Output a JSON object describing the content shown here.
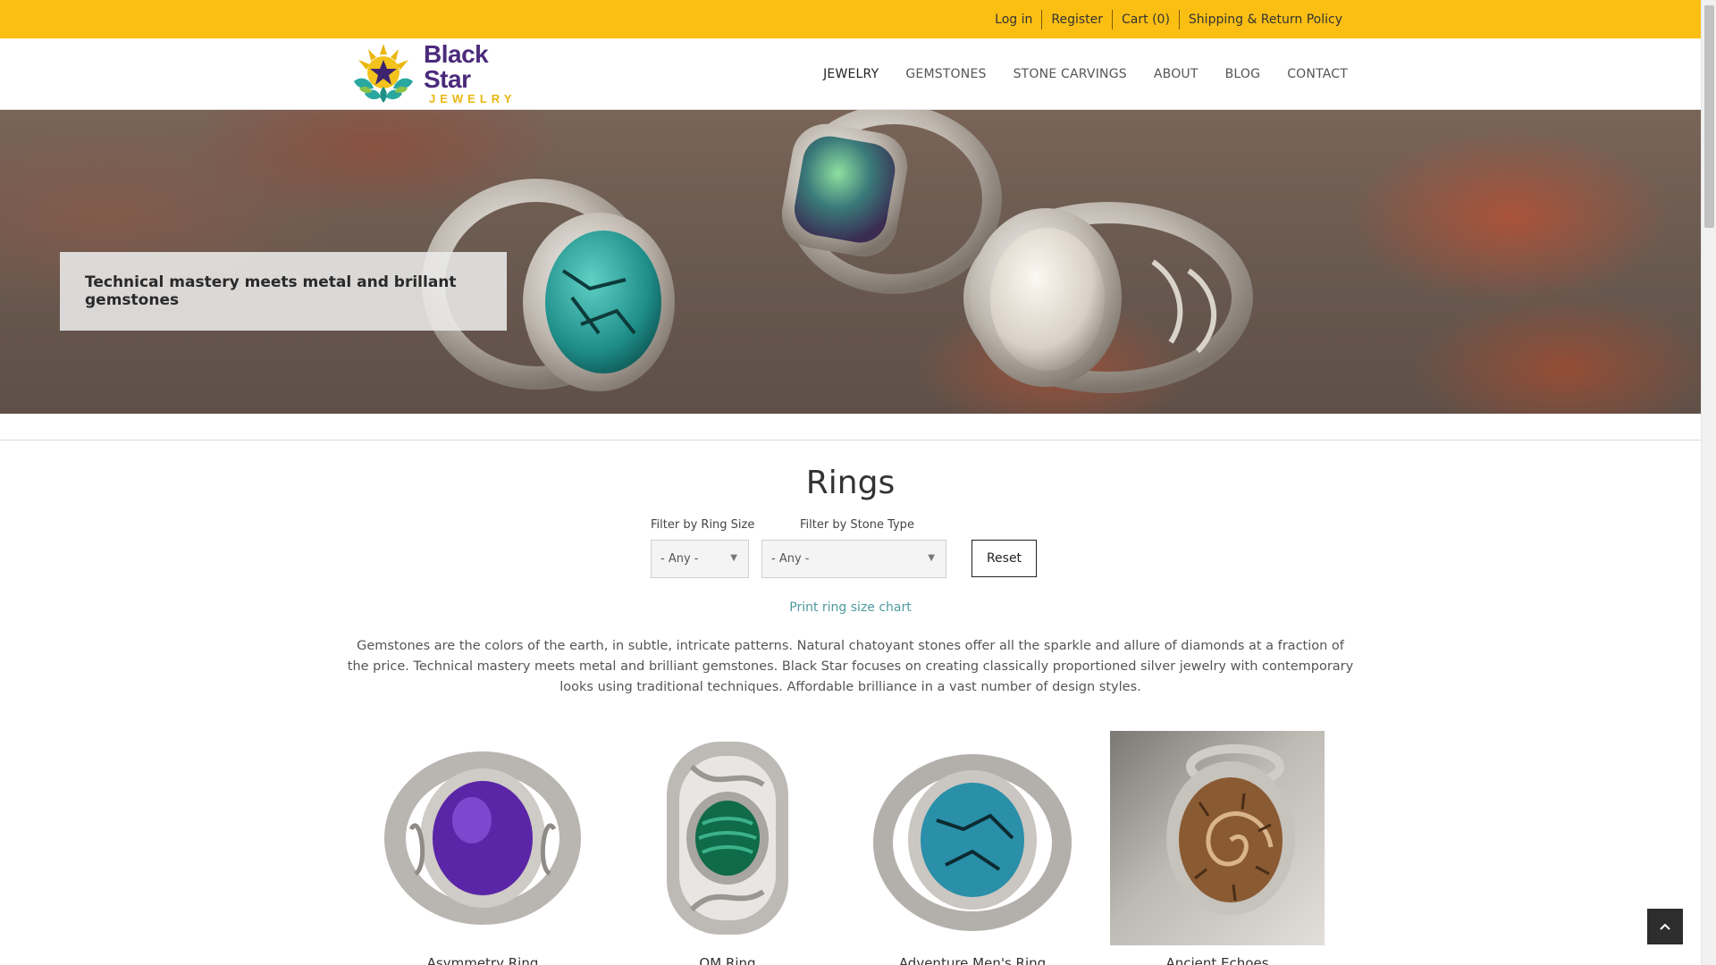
{
  "topbar": {
    "links": [
      "Log in",
      "Register",
      "Cart (0)",
      "Shipping & Return Policy"
    ]
  },
  "logo": {
    "line1": "Black Star",
    "line2": "JEWELRY",
    "colors": {
      "purple": "#4b2a7b",
      "gold": "#e9b70f",
      "teal": "#2aa8a0"
    }
  },
  "nav": {
    "items": [
      "JEWELRY",
      "GEMSTONES",
      "STONE CARVINGS",
      "ABOUT",
      "BLOG",
      "CONTACT"
    ],
    "active": "JEWELRY"
  },
  "hero": {
    "caption": "Technical mastery meets metal and brillant gemstones"
  },
  "main": {
    "title": "Rings",
    "filters": {
      "ring_size": {
        "label": "Filter by Ring Size",
        "value": "- Any -"
      },
      "stone_type": {
        "label": "Filter by Stone Type",
        "value": "- Any -"
      },
      "reset_label": "Reset"
    },
    "print_link": "Print ring size chart",
    "intro": "Gemstones are the colors of the earth, in subtle, intricate patterns. Natural chatoyant stones offer all the sparkle and allure of diamonds at a fraction of the price.  Technical mastery meets metal and brilliant gemstones. Black Star focuses on creating classically proportioned silver jewelry with contemporary looks using traditional techniques. Affordable brilliance in a vast number of design styles."
  },
  "products": [
    {
      "name": "Asymmetry Ring",
      "stone": "amethyst"
    },
    {
      "name": "OM Ring",
      "stone": "malachite"
    },
    {
      "name": "Adventure Men's Ring",
      "stone": "turquoise"
    },
    {
      "name": "Ancient Echoes",
      "stone": "ammonite"
    }
  ],
  "colors": {
    "topbar": "#fbbf14",
    "link": "#4f9a9e",
    "back_to_top": "#2d2d2d"
  },
  "icons": {
    "back_to_top": "chevron-up-icon",
    "select_arrow": "caret-down-icon"
  }
}
